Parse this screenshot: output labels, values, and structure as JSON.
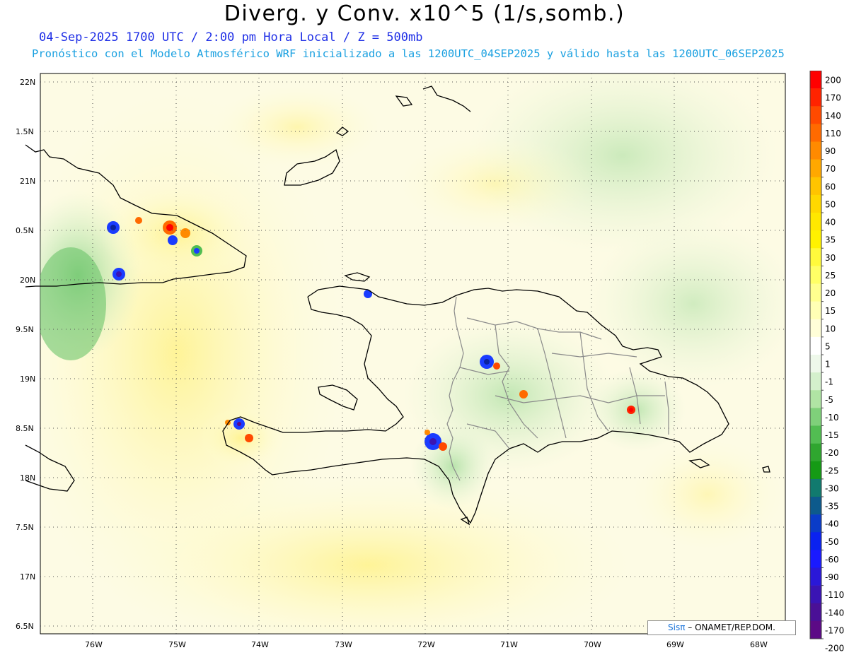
{
  "header": {
    "title": "Diverg. y Conv. x10^5 (1/s,somb.)",
    "subtitle": "04-Sep-2025  1700 UTC / 2:00 pm Hora Local / Z = 500mb",
    "info": "Pronóstico con el Modelo Atmosférico WRF inicializado a las 1200UTC_04SEP2025 y válido hasta las  1200UTC_06SEP2025"
  },
  "lat_labels": [
    "22N",
    "1.5N",
    "21N",
    "0.5N",
    "20N",
    "9.5N",
    "19N",
    "8.5N",
    "18N",
    "7.5N",
    "17N",
    "6.5N"
  ],
  "lon_labels": [
    "76W",
    "75W",
    "74W",
    "73W",
    "72W",
    "71W",
    "70W",
    "69W",
    "68W"
  ],
  "colorbar": {
    "labels": [
      "200",
      "170",
      "140",
      "110",
      "90",
      "70",
      "60",
      "50",
      "40",
      "35",
      "30",
      "25",
      "20",
      "15",
      "10",
      "5",
      "1",
      "-1",
      "-5",
      "-10",
      "-15",
      "-20",
      "-25",
      "-30",
      "-35",
      "-40",
      "-50",
      "-60",
      "-90",
      "-110",
      "-140",
      "-170",
      "-200"
    ],
    "colors": [
      "#ff0000",
      "#ff2300",
      "#ff4a00",
      "#ff6a00",
      "#ff8a00",
      "#ffa800",
      "#ffc400",
      "#ffd800",
      "#ffe800",
      "#fff200",
      "#fffa3c",
      "#ffff66",
      "#ffff8f",
      "#ffffb5",
      "#fffed8",
      "#ffffff",
      "#eef8ea",
      "#d4f0cc",
      "#b0e4a4",
      "#7fd07a",
      "#52bd52",
      "#2fa62f",
      "#159a15",
      "#117a6e",
      "#0d5a8c",
      "#0a3cc8",
      "#0a22f0",
      "#1a1aff",
      "#2a18d8",
      "#3a14b4",
      "#4a1096",
      "#5c0a86"
    ]
  },
  "credit": {
    "logo": "Sisπ",
    "text": "– ONAMET/REP.DOM."
  }
}
